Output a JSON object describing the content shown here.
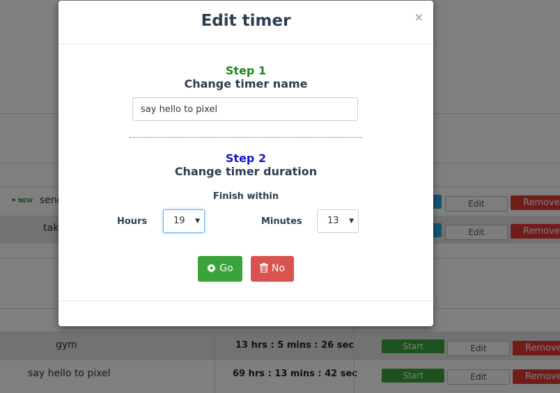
{
  "background": {
    "rows": [
      {
        "name": "send",
        "badge": "NEW",
        "actions": {
          "edit": "Edit",
          "remove": "Remove"
        }
      },
      {
        "name": "take",
        "actions": {
          "edit": "Edit",
          "remove": "Remove"
        }
      },
      {
        "name": "gym",
        "duration": "13 hrs : 5 mins : 26 sec",
        "actions": {
          "start": "Start",
          "edit": "Edit",
          "remove": "Remove"
        }
      },
      {
        "name": "say hello to pixel",
        "duration": "69 hrs : 13 mins : 42 sec",
        "actions": {
          "start": "Start",
          "edit": "Edit",
          "remove": "Remove"
        }
      }
    ]
  },
  "modal": {
    "title": "Edit timer",
    "close_symbol": "×",
    "step1": {
      "label": "Step 1",
      "title": "Change timer name",
      "input_value": "say hello to pixel"
    },
    "step2": {
      "label": "Step 2",
      "title": "Change timer duration",
      "finish_label": "Finish within",
      "hours_label": "Hours",
      "hours_value": "19",
      "minutes_label": "Minutes",
      "minutes_value": "13"
    },
    "go_label": "Go",
    "no_label": "No",
    "icons": {
      "go": "gear-icon",
      "no": "trash-icon"
    },
    "colors": {
      "step1": "#1a8a1a",
      "step2": "#1515cc",
      "go": "#3aa33a",
      "no": "#d9534f"
    }
  }
}
